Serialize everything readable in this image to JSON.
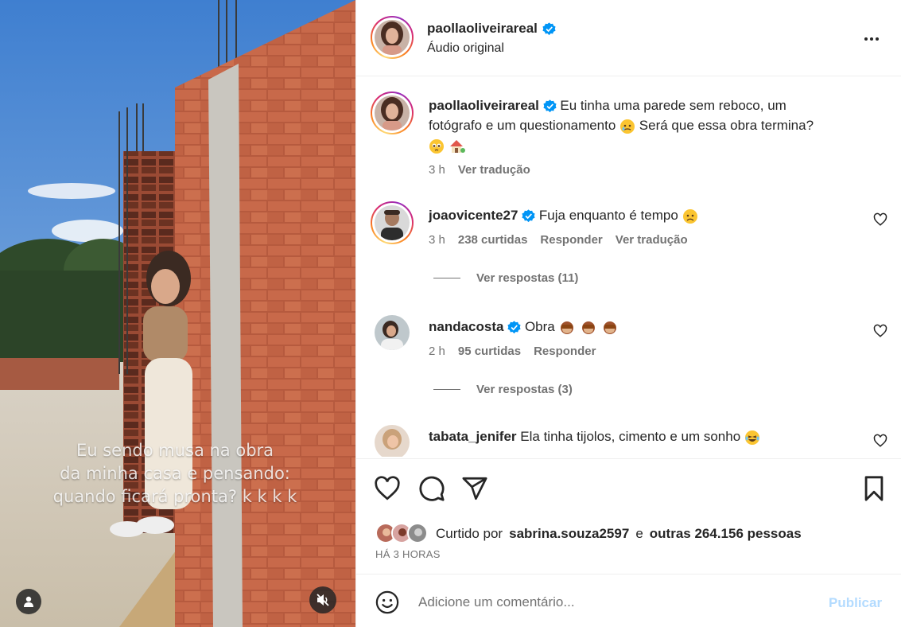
{
  "media": {
    "overlay_lines": [
      "Eu sendo musa na obra",
      "da minha casa e pensando:",
      "quando ficará pronta? k k k k"
    ]
  },
  "header": {
    "username": "paollaoliveirareal",
    "subtitle": "Áudio original"
  },
  "caption": {
    "username": "paollaoliveirareal",
    "text_line1": "Eu tinha uma parede sem reboco, um",
    "text_line2": "fotógrafo e um questionamento",
    "text_line2b": "Será que essa obra termina?",
    "time": "3 h",
    "translate": "Ver tradução"
  },
  "comments": [
    {
      "username": "joaovicente27",
      "verified": true,
      "text": "Fuja enquanto é tempo",
      "time": "3 h",
      "likes": "238 curtidas",
      "reply": "Responder",
      "translate": "Ver tradução",
      "view_replies": "Ver respostas (11)"
    },
    {
      "username": "nandacosta",
      "verified": true,
      "text": "Obra",
      "time": "2 h",
      "likes": "95 curtidas",
      "reply": "Responder",
      "view_replies": "Ver respostas (3)"
    },
    {
      "username": "tabata_jenifer",
      "verified": false,
      "text": "Ela tinha tijolos, cimento e um sonho"
    }
  ],
  "actions": {
    "liked_by_prefix": "Curtido por",
    "liked_by_user": "sabrina.souza2597",
    "liked_by_and": "e",
    "liked_by_others": "outras 264.156 pessoas",
    "timestamp": "HÁ 3 HORAS"
  },
  "add_comment": {
    "placeholder": "Adicione um comentário...",
    "publish": "Publicar"
  },
  "icons": {
    "verified": "verified-badge-icon",
    "more": "more-options-icon",
    "heart": "heart-icon",
    "comment": "comment-icon",
    "share": "share-icon",
    "save": "bookmark-icon",
    "emoji": "emoji-icon",
    "mute": "muted-speaker-icon",
    "user": "user-tag-icon"
  },
  "colors": {
    "verified": "#0095f6",
    "publish_disabled": "#b3dbff",
    "secondary_text": "#737373"
  }
}
